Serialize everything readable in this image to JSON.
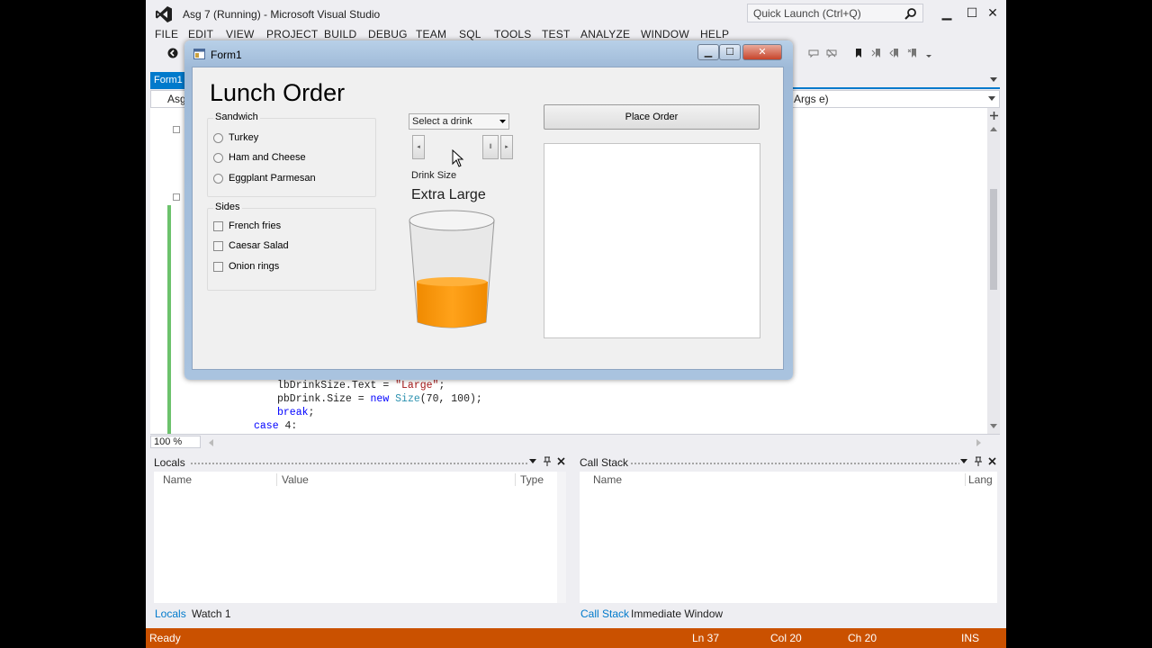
{
  "window": {
    "title": "Asg 7 (Running) - Microsoft Visual Studio",
    "quick_launch_placeholder": "Quick Launch (Ctrl+Q)",
    "minimize_glyph": "▁",
    "maximize_glyph": "☐",
    "close_glyph": "✕"
  },
  "menu": [
    "FILE",
    "EDIT",
    "VIEW",
    "PROJECT",
    "BUILD",
    "DEBUG",
    "TEAM",
    "SQL",
    "TOOLS",
    "TEST",
    "ANALYZE",
    "WINDOW",
    "HELP"
  ],
  "doc_tab": {
    "label": "Form1"
  },
  "navbar": {
    "left": "Asg",
    "right": "Args e)"
  },
  "code_lines": [
    "lbDrinkSize.Text = \"Large\";",
    "pbDrink.Size = new Size(70, 100);",
    "break;",
    "case 4:"
  ],
  "zoom": "100 %",
  "locals_panel": {
    "title": "Locals",
    "columns": [
      "Name",
      "Value",
      "Type"
    ],
    "tabs": [
      "Locals",
      "Watch 1"
    ]
  },
  "callstack_panel": {
    "title": "Call Stack",
    "columns": [
      "Name",
      "Lang"
    ],
    "tabs": [
      "Call Stack",
      "Immediate Window"
    ]
  },
  "status": {
    "state": "Ready",
    "line": "Ln 37",
    "col": "Col 20",
    "ch": "Ch 20",
    "mode": "INS"
  },
  "form": {
    "title": "Form1",
    "heading": "Lunch Order",
    "sandwich_group": {
      "title": "Sandwich",
      "options": [
        "Turkey",
        "Ham and Cheese",
        "Eggplant Parmesan"
      ]
    },
    "sides_group": {
      "title": "Sides",
      "options": [
        "French fries",
        "Caesar Salad",
        "Onion rings"
      ]
    },
    "drink_combo": "Select a drink",
    "drink_size_label": "Drink Size",
    "drink_size_value": "Extra Large",
    "drink_scroll_fraction": 1.0,
    "place_order_label": "Place Order"
  },
  "colors": {
    "vs_accent": "#007acc",
    "status_bar": "#ca5100",
    "drink_fill": "#ff9b10"
  }
}
